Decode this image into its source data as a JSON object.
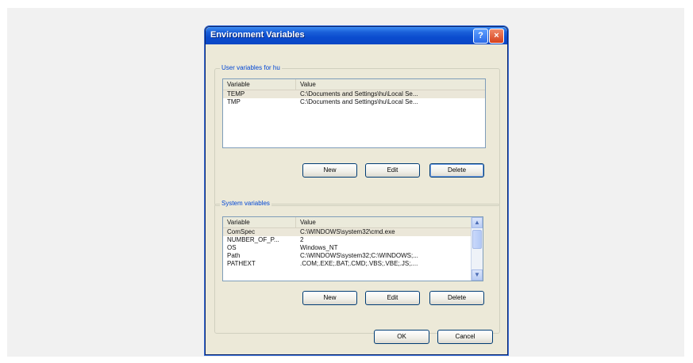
{
  "dialog": {
    "title": "Environment Variables",
    "help_icon": "?",
    "close_icon": "×"
  },
  "user_vars": {
    "group_label": "User variables for hu",
    "col_variable": "Variable",
    "col_value": "Value",
    "rows": [
      {
        "variable": "TEMP",
        "value": "C:\\Documents and Settings\\hu\\Local Se..."
      },
      {
        "variable": "TMP",
        "value": "C:\\Documents and Settings\\hu\\Local Se..."
      }
    ],
    "new_label": "New",
    "edit_label": "Edit",
    "delete_label": "Delete"
  },
  "system_vars": {
    "group_label": "System variables",
    "col_variable": "Variable",
    "col_value": "Value",
    "rows": [
      {
        "variable": "ComSpec",
        "value": "C:\\WINDOWS\\system32\\cmd.exe"
      },
      {
        "variable": "NUMBER_OF_P...",
        "value": "2"
      },
      {
        "variable": "OS",
        "value": "Windows_NT"
      },
      {
        "variable": "Path",
        "value": "C:\\WINDOWS\\system32;C:\\WINDOWS;..."
      },
      {
        "variable": "PATHEXT",
        "value": ".COM;.EXE;.BAT;.CMD;.VBS;.VBE;.JS;...."
      }
    ],
    "scroll_up": "▲",
    "scroll_down": "▼",
    "new_label": "New",
    "edit_label": "Edit",
    "delete_label": "Delete"
  },
  "footer": {
    "ok_label": "OK",
    "cancel_label": "Cancel"
  }
}
